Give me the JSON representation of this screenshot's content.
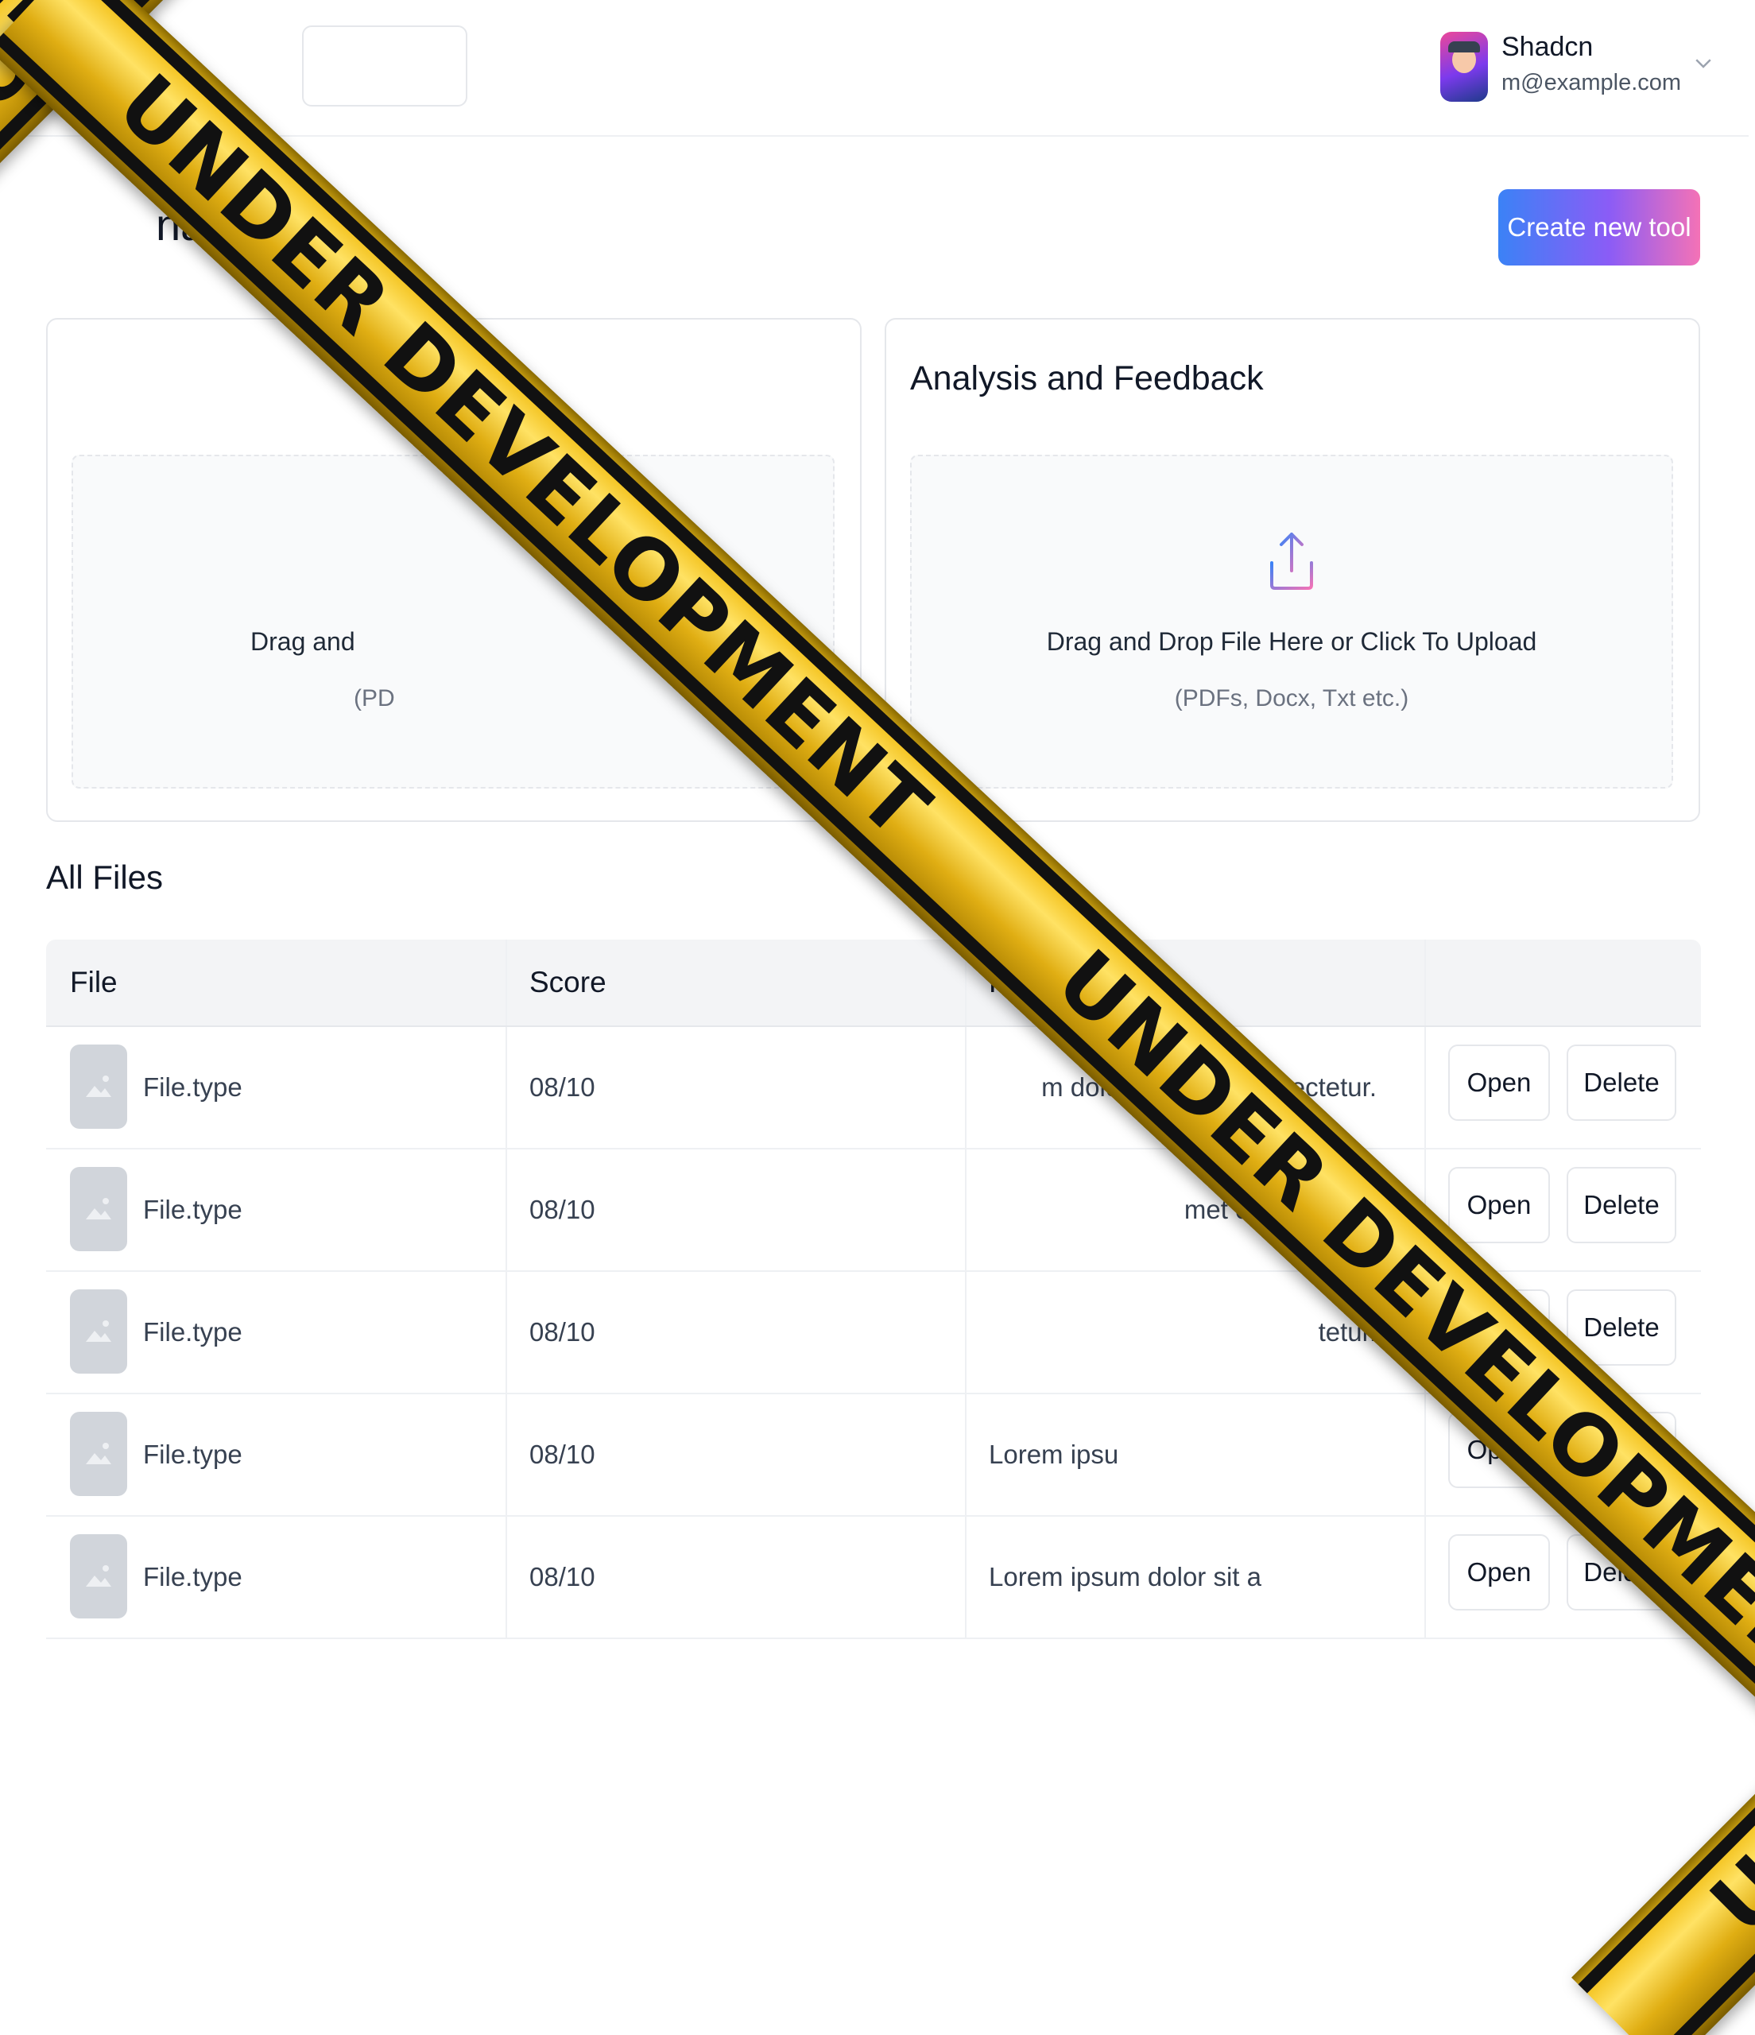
{
  "header": {
    "user_name": "Shadcn",
    "user_email": "m@example.com"
  },
  "page": {
    "title_visible": "nalysis",
    "create_button": "Create new tool"
  },
  "cards": [
    {
      "title": "",
      "drop_text": "Drag and",
      "drop_sub": "(PD"
    },
    {
      "title": "Analysis and Feedback",
      "drop_text": "Drag and Drop File Here or Click To Upload",
      "drop_sub": "(PDFs, Docx, Txt etc.)"
    }
  ],
  "files": {
    "section_title": "All Files",
    "columns": [
      "File",
      "Score",
      "Feedback",
      ""
    ],
    "open_label": "Open",
    "delete_label": "Delete",
    "rows": [
      {
        "file": "File.type",
        "score": "08/10",
        "feedback": "m dolor sit amet consectetur."
      },
      {
        "file": "File.type",
        "score": "08/10",
        "feedback": "met consectetur."
      },
      {
        "file": "File.type",
        "score": "08/10",
        "feedback": "tetur."
      },
      {
        "file": "File.type",
        "score": "08/10",
        "feedback": "Lorem ipsu"
      },
      {
        "file": "File.type",
        "score": "08/10",
        "feedback": "Lorem ipsum dolor sit a"
      }
    ]
  },
  "overlay": {
    "tape_main": "UNDER DEVELOPMENT       UNDER DEVELOPMENT",
    "tape_left": "UNDER DEVELOPMENT",
    "tape_corner": "UNDER"
  },
  "colors": {
    "accent_gradient": [
      "#3b82f6",
      "#8b5cf6",
      "#f472b6"
    ],
    "tape_yellow": "#f3c21e",
    "tape_black": "#111111"
  },
  "icons": {
    "upload": "upload-icon",
    "chevron": "chevron-down-icon",
    "thumbnail": "image-placeholder-icon"
  }
}
